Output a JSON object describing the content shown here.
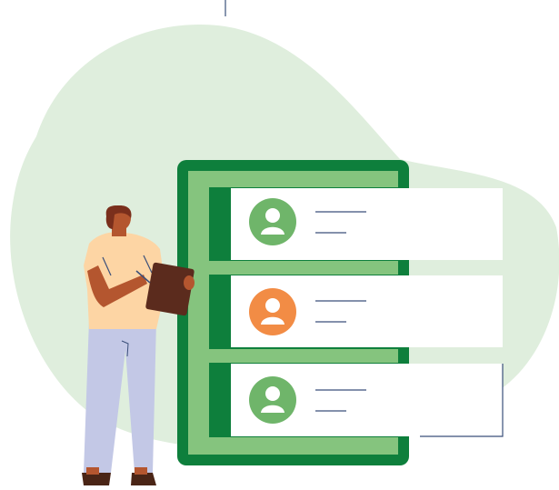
{
  "illustration": {
    "colors": {
      "blob": "#dfeedd",
      "board_dark": "#0e7f3c",
      "board_light": "#85c47e",
      "card_bg": "#ffffff",
      "avatar_green": "#6fb56a",
      "avatar_orange": "#f28c45",
      "text_line": "#3a4f7a",
      "skin": "#b4562f",
      "shirt": "#fdd5a4",
      "pants": "#c3c8e6",
      "hair": "#7a2f1c",
      "clipboard": "#5b2b1d",
      "shoes": "#4a2516"
    },
    "cards": [
      {
        "avatar_icon": "user-icon",
        "avatar_color": "green"
      },
      {
        "avatar_icon": "user-icon",
        "avatar_color": "orange"
      },
      {
        "avatar_icon": "user-icon",
        "avatar_color": "green"
      }
    ],
    "character": "person-with-clipboard"
  }
}
